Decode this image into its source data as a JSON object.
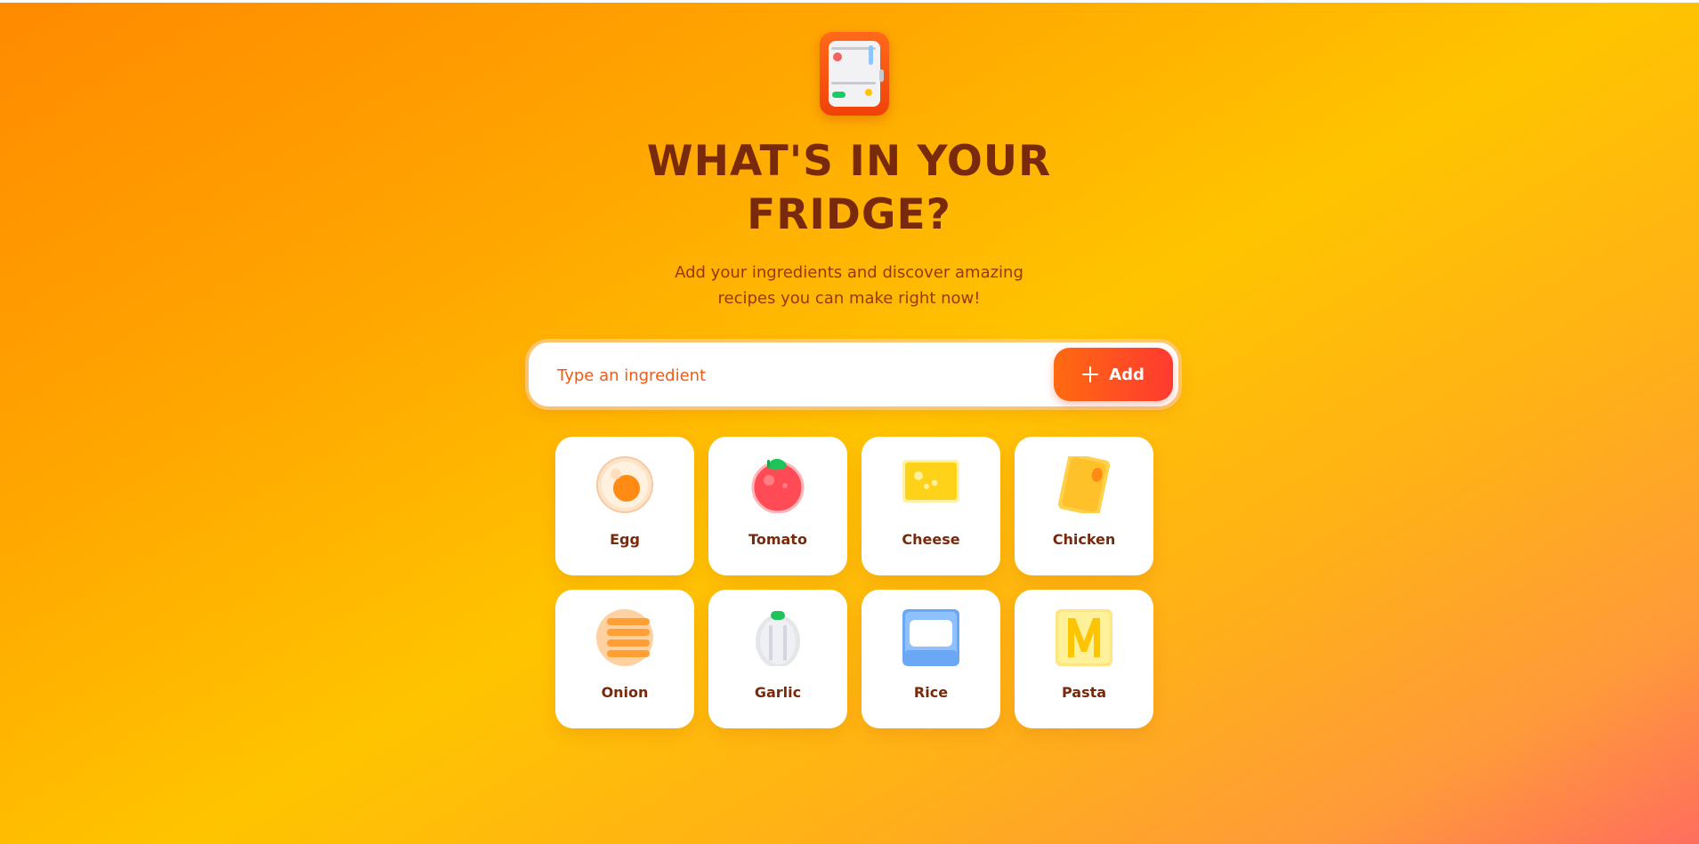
{
  "header": {
    "logo_icon": "fridge-icon",
    "title_line1": "WHAT'S IN YOUR",
    "title_line2": "FRIDGE?",
    "subtitle_line1": "Add your ingredients and discover amazing",
    "subtitle_line2": "recipes you can make right now!"
  },
  "search": {
    "placeholder": "Type an ingredient",
    "value": "",
    "add_label": "Add",
    "add_icon": "plus-icon"
  },
  "ingredients": [
    {
      "label": "Egg",
      "icon": "egg-icon"
    },
    {
      "label": "Tomato",
      "icon": "tomato-icon"
    },
    {
      "label": "Cheese",
      "icon": "cheese-icon"
    },
    {
      "label": "Chicken",
      "icon": "chicken-icon"
    },
    {
      "label": "Onion",
      "icon": "onion-icon"
    },
    {
      "label": "Garlic",
      "icon": "garlic-icon"
    },
    {
      "label": "Rice",
      "icon": "rice-icon"
    },
    {
      "label": "Pasta",
      "icon": "pasta-icon"
    }
  ],
  "colors": {
    "heading": "#7a2a0c",
    "accent": "#ff5a1a",
    "background_start": "#ff8a00",
    "background_end": "#ff6e5e"
  }
}
